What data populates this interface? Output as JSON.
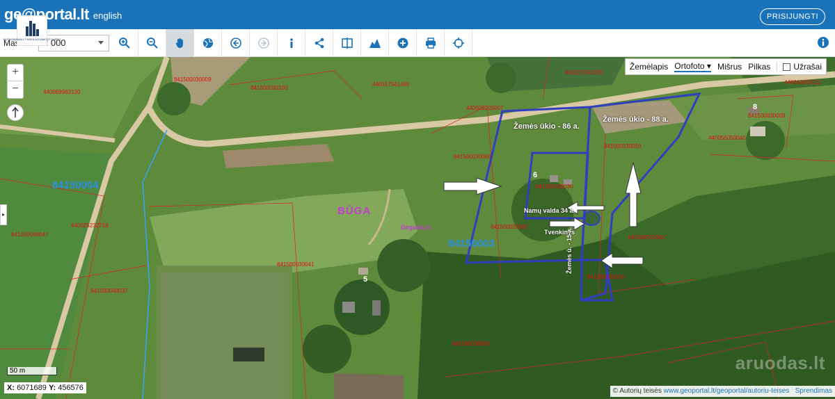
{
  "header": {
    "logo": "ge@portal.lt",
    "language_link": "english",
    "login_button": "PRISIJUNGTI"
  },
  "company_logo": {
    "text": "BUTAIDNAMAI.LT NEKILNOJAMOJO TURTO"
  },
  "toolbar": {
    "scale_label": "Mas",
    "scale_value": "2 000",
    "tools": [
      "zoom-in",
      "zoom-out",
      "pan",
      "globe",
      "back",
      "forward",
      "info",
      "share",
      "compare",
      "profile",
      "add",
      "print",
      "locate"
    ],
    "active_tool": "pan"
  },
  "map": {
    "layer_switch": {
      "options": [
        "Žemėlapis",
        "Ortofoto",
        "Mišrus",
        "Pilkas"
      ],
      "selected": "Ortofoto",
      "labels_checkbox": "Užrašai",
      "labels_checked": false
    },
    "zoom_in": "+",
    "zoom_out": "−",
    "scalebar": "50 m",
    "coordinates": {
      "x_label": "X:",
      "x": "6071689",
      "y_label": "Y:",
      "y": "456576"
    },
    "attribution": {
      "symbol": "©",
      "text": "Autorių teisės",
      "link": "www.geoportal.lt/geoportal/autoriu-teises",
      "extra": "Sprendimas"
    },
    "watermark": "aruodas.lt",
    "blocks": [
      {
        "id": "84150004"
      },
      {
        "id": "84150003"
      }
    ],
    "village": "BŪGA",
    "place": "Degučių k.",
    "annotations": {
      "plot1": "Žemės ūkio - 86 a.",
      "plot2": "Žemės ūkio - 88 a.",
      "homestead": "Namų valda 34 a.",
      "pond": "Tvenkinys",
      "plot3": "Žemės ū. - 15 a."
    },
    "house_numbers": [
      "6",
      "5",
      "8"
    ],
    "parcels": [
      "841500030009",
      "440069962130",
      "841500030100",
      "440317541455",
      "440317541378",
      "440040050012",
      "440026225007",
      "841500030009",
      "440056050040",
      "841500030050",
      "841500030080",
      "841500040047",
      "440025232718",
      "841500030060",
      "440058953360",
      "841500030030",
      "841500030041",
      "841500040037",
      "841500030080",
      "841500030100"
    ]
  }
}
